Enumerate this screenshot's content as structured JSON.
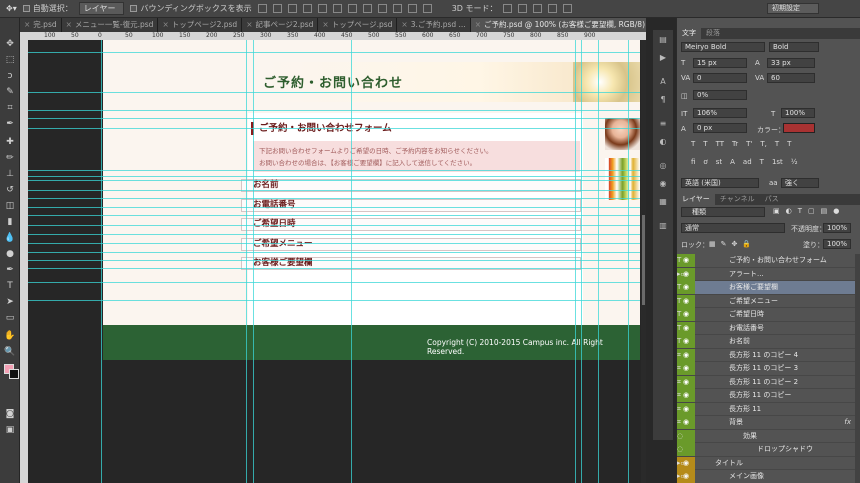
{
  "optionsbar": {
    "auto_select_label": "自動選択：",
    "layer_select": "レイヤー",
    "bounding_box_label": "バウンディングボックスを表示",
    "mode3d_label": "3D モード：",
    "workspace_select": "初期設定"
  },
  "tabs": [
    {
      "label": "完.psd"
    },
    {
      "label": "メニュー一覧-復元.psd"
    },
    {
      "label": "トップページ2.psd"
    },
    {
      "label": "記事ページ2.psd"
    },
    {
      "label": "トップページ.psd"
    },
    {
      "label": "3.ご予約.psd ..."
    },
    {
      "label": "ご予約.psd @ 100% (お客様ご要望欄, RGB/8)"
    }
  ],
  "ruler": {
    "ticks": [
      "100",
      "50",
      "0",
      "50",
      "100",
      "150",
      "200",
      "250",
      "300",
      "350",
      "400",
      "450",
      "500",
      "550",
      "600",
      "650",
      "700",
      "750",
      "800",
      "850",
      "900"
    ]
  },
  "document": {
    "page_title": "ご予約・お問い合わせ",
    "form_heading": "ご予約・お問い合わせフォーム",
    "notice_line1": "下記お問い合わせフォームよりご希望の日時、ご予約内容をお知らせください。",
    "notice_line2": "お問い合わせの場合は、【お客様ご要望欄】に記入して送信してください。",
    "fields": [
      {
        "label": "お名前"
      },
      {
        "label": "お電話番号"
      },
      {
        "label": "ご希望日時"
      },
      {
        "label": "ご希望メニュー"
      },
      {
        "label": "お客様ご要望欄"
      }
    ],
    "copyright": "Copyright (C) 2010-2015 Campus inc. All Right Reserved."
  },
  "char_panel": {
    "tabs": [
      "文字",
      "段落"
    ],
    "font_family": "Meiryo Bold",
    "font_style": "Bold",
    "size": "15 px",
    "leading": "33 px",
    "kerning": "0",
    "tracking": "60",
    "scale_pct": "0%",
    "vscale": "106%",
    "hscale": "100%",
    "baseline": "0 px",
    "color_label": "カラー：",
    "color": "#a83232",
    "type_buttons": [
      "T",
      "T",
      "TT",
      "Tr",
      "T'",
      "T,",
      "T",
      "T"
    ],
    "ot_buttons": [
      "fi",
      "ơ",
      "st",
      "A",
      "ad",
      "T",
      "1st",
      "½"
    ],
    "language": "英語 (米国)",
    "aa_label": "aa",
    "aa": "強く"
  },
  "layers_panel": {
    "tabs": [
      "レイヤー",
      "チャンネル",
      "パス"
    ],
    "filter": "種類",
    "blend_mode": "通常",
    "opacity_label": "不透明度：",
    "opacity": "100%",
    "lock_label": "ロック：",
    "fill_label": "塗り：",
    "fill": "100%",
    "layers": [
      {
        "name": "ご予約・お問い合わせフォーム",
        "kind": "text",
        "indent": 1,
        "eye": true
      },
      {
        "name": "アラート...",
        "kind": "folder",
        "indent": 1,
        "eye": true
      },
      {
        "name": "お客様ご要望欄",
        "kind": "text",
        "indent": 1,
        "eye": true,
        "selected": true
      },
      {
        "name": "ご希望メニュー",
        "kind": "text",
        "indent": 1,
        "eye": true
      },
      {
        "name": "ご希望日時",
        "kind": "text",
        "indent": 1,
        "eye": true
      },
      {
        "name": "お電話番号",
        "kind": "text",
        "indent": 1,
        "eye": true
      },
      {
        "name": "お名前",
        "kind": "text",
        "indent": 1,
        "eye": true
      },
      {
        "name": "長方形 11 のコピー 4",
        "kind": "shape",
        "indent": 1,
        "eye": true
      },
      {
        "name": "長方形 11 のコピー 3",
        "kind": "shape",
        "indent": 1,
        "eye": true
      },
      {
        "name": "長方形 11 のコピー 2",
        "kind": "shape",
        "indent": 1,
        "eye": true
      },
      {
        "name": "長方形 11 のコピー",
        "kind": "shape",
        "indent": 1,
        "eye": true
      },
      {
        "name": "長方形 11",
        "kind": "shape",
        "indent": 1,
        "eye": true
      },
      {
        "name": "背景",
        "kind": "shape",
        "indent": 1,
        "eye": true,
        "fx": "fx"
      },
      {
        "name": "効果",
        "kind": "effect",
        "indent": 2,
        "eye": false
      },
      {
        "name": "ドロップシャドウ",
        "kind": "effect",
        "indent": 3,
        "eye": false
      },
      {
        "name": "タイトル",
        "kind": "folder",
        "indent": 0,
        "eye": true,
        "yellow": true
      },
      {
        "name": "メイン画像",
        "kind": "folder",
        "indent": 1,
        "eye": true,
        "yellow": true
      }
    ]
  }
}
